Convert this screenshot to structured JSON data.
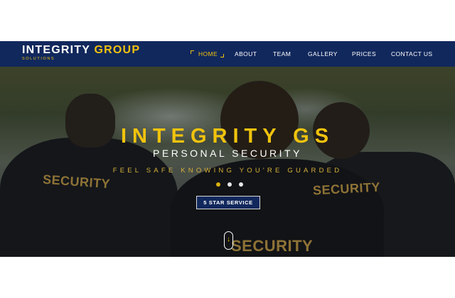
{
  "brand": {
    "name_part1": "INTEGRITY",
    "name_part2": "GROUP",
    "sub": "SOLUTIONS"
  },
  "nav": {
    "items": [
      {
        "label": "HOME",
        "active": true
      },
      {
        "label": "ABOUT"
      },
      {
        "label": "TEAM"
      },
      {
        "label": "GALLERY"
      },
      {
        "label": "PRICES"
      },
      {
        "label": "CONTACT US"
      }
    ]
  },
  "hero": {
    "title": "INTEGRITY GS",
    "subtitle": "PERSONAL SECURITY",
    "tagline": "FEEL SAFE KNOWING YOU'RE GUARDED",
    "slide_count": 3,
    "active_slide": 1,
    "cta_label": "5 STAR SERVICE",
    "scroll_icon": "arrow-down-icon",
    "photo_text": {
      "patch_left": "SECURITY",
      "patch_right": "SECURITY",
      "patch_center": "SECURITY"
    }
  },
  "colors": {
    "nav_bg": "#11285d",
    "accent": "#f1c30d",
    "text_light": "#ffffff"
  }
}
